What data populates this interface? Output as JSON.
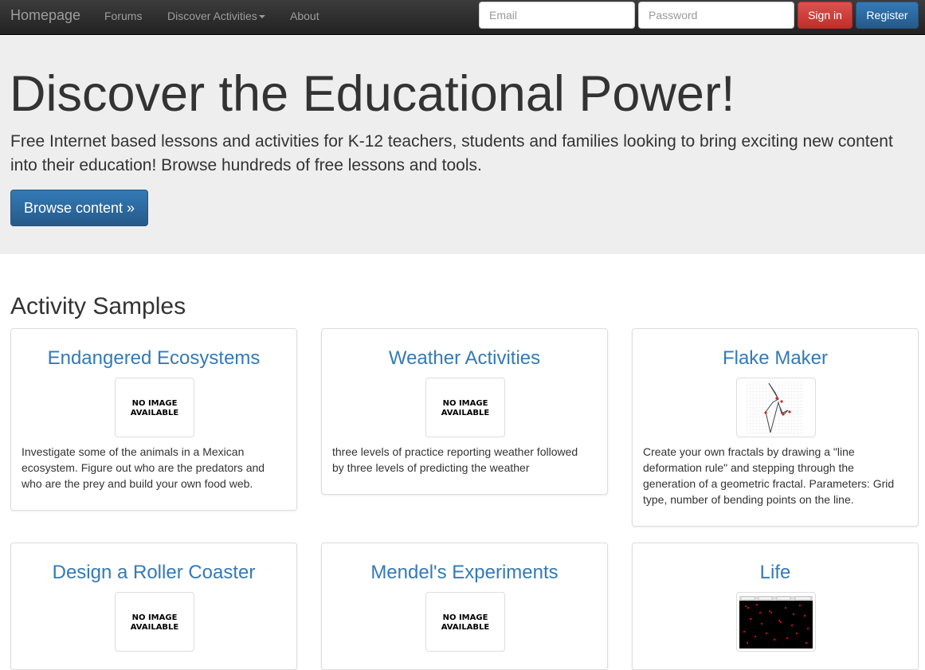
{
  "navbar": {
    "brand": "Homepage",
    "links": [
      "Forums",
      "Discover Activities",
      "About"
    ],
    "email_placeholder": "Email",
    "password_placeholder": "Password",
    "signin_label": "Sign in",
    "register_label": "Register"
  },
  "jumbotron": {
    "title": "Discover the Educational Power!",
    "text": "Free Internet based lessons and activities for K-12 teachers, students and families looking to bring exciting new content into their education! Browse hundreds of free lessons and tools.",
    "button_label": "Browse content »"
  },
  "section": {
    "title": "Activity Samples",
    "no_image_line1": "NO IMAGE",
    "no_image_line2": "AVAILABLE",
    "cards": [
      {
        "title": "Endangered Ecosystems",
        "image": "no-image",
        "description": "Investigate some of the animals in a Mexican ecosystem. Figure out who are the predators and who are the prey and build your own food web."
      },
      {
        "title": "Weather Activities",
        "image": "no-image",
        "description": "three levels of practice reporting weather followed by three levels of predicting the weather"
      },
      {
        "title": "Flake Maker",
        "image": "fractal-thumbnail",
        "description": "Create your own fractals by drawing a \"line deformation rule\" and stepping through the generation of a geometric fractal. Parameters: Grid type, number of bending points on the line."
      },
      {
        "title": "Design a Roller Coaster",
        "image": "no-image",
        "description": ""
      },
      {
        "title": "Mendel's Experiments",
        "image": "no-image",
        "description": ""
      },
      {
        "title": "Life",
        "image": "life-game-thumbnail",
        "description": ""
      }
    ]
  },
  "colors": {
    "link": "#337ab7",
    "danger": "#d9534f",
    "primary": "#337ab7",
    "jumbotron_bg": "#eeeeee",
    "navbar_bg": "#222222"
  }
}
